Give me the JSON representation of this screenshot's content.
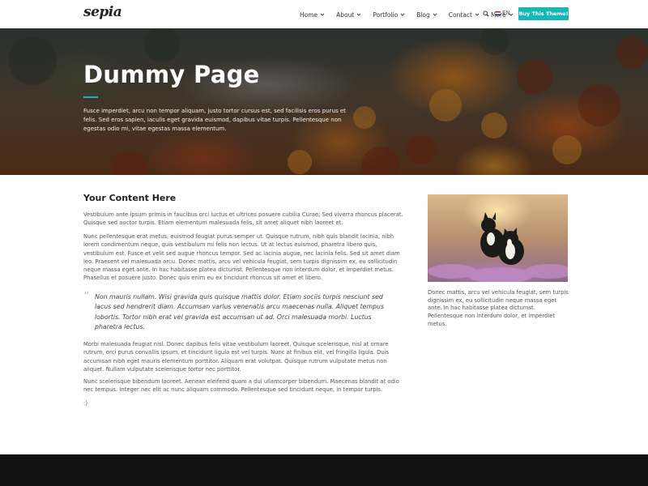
{
  "header": {
    "logo": "sepia",
    "nav": [
      {
        "label": "Home",
        "has_dropdown": true
      },
      {
        "label": "About",
        "has_dropdown": true
      },
      {
        "label": "Portfolio",
        "has_dropdown": true
      },
      {
        "label": "Blog",
        "has_dropdown": true
      },
      {
        "label": "Contact",
        "has_dropdown": true
      },
      {
        "label": "More",
        "has_dropdown": true
      }
    ],
    "search_icon": "search-icon",
    "language": "EN",
    "buy_label": "Buy This Theme!"
  },
  "hero": {
    "title": "Dummy Page",
    "text": "Fusce imperdiet, arcu non tempor aliquam, justo tortor cursus est, sed facilisis eros purus et felis. Sed eros sapien, iaculis eget gravida euismod, dapibus vitae turpis. Pellentesque non egestas odio mi, vitae egestas massa elementum."
  },
  "main": {
    "heading": "Your Content Here",
    "p1": "Vestibulum ante ipsum primis in faucibus orci luctus et ultrices posuere cubilia Curae; Sed viverra rhoncus placerat. Quisque sed auctor turpis. Etiam elementum malesuada felis, sit amet aliquet nibh laoreet et.",
    "p2": "Nunc pellentesque erat metus, euismod feugiat purus semper ut. Quisque rutrum, nibh quis blandit lacinia, nibh lorem condimentum neque, quis vestibulum mi felis non lectus. Ut at lectus euismod, pharetra libero quis, vestibulum est. Fusce et velit sed augue rhoncus tempor. Sed ac lacinia augue, nec lacinia felis. Sed sit amet diam leo. Praesent vel malesuada arcu. Donec mattis, arcu vel vehicula feugiat, sem turpis dignissim ex, eu sollicitudin neque massa eget ante. In hac habitasse platea dictumst. Pellentesque non interdum dolor, et imperdiet metus. Phasellus et posuere justo. Donec quis enim eu ex tincidunt rhoncus sit amet et libero.",
    "quote": "Non mauris nullam. Wisi gravida quis quisque mattis dolor. Etiam sociis turpis nesciunt sed lacus sed hendrerit diam. Accumsan varius venenatis arcu maecenas nulla. Aliquet tempus lobortis. Tortor nibh erat vel gravida est accumsan ut ad. Orci malesuada morbi. Luctus pharetra lectus.",
    "p3": "Morbi malesuada feugiat nisl. Donec dapibus felis vitae vestibulum laoreet. Quisque scelerisque, nisl at ornare rutrum, orci purus convallis ipsum, et tincidunt ligula est vel turpis. Nunc at finibus elit, vel fringilla ligula. Duis accumsan nibh eget mauris elementum porttitor. Aliquam erat volutpat. Quisque rutrum vulputate metus non aliquet. Nullam vulputate scelerisque tortor nec porttitor.",
    "p4": "Nunc scelerisque bibendum laoreet. Aenean eleifend quam a dui ullamcorper bibendum. Maecenas blandit at odio nec tempus. Integer nec elit ac nunc aliquam commodo. Pellentesque sed tincidunt neque, in tempor turpis.",
    "smiley": ":)"
  },
  "sidebar": {
    "caption": "Donec mattis, arcu vel vehicula feugiat, sem turpis dignissim ex, eu sollicitudin neque massa eget ante. In hac habitasse platea dictumst. Pellentesque non interdum dolor, et imperdiet metus."
  },
  "colors": {
    "accent": "#14b8b8",
    "footer": "#111111"
  }
}
